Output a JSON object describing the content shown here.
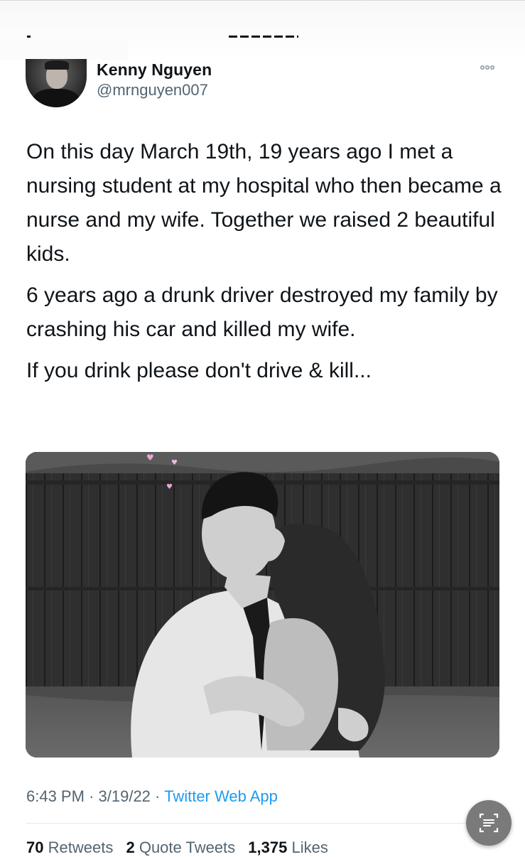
{
  "author": {
    "name": "Kenny Nguyen",
    "handle": "@mrnguyen007"
  },
  "tweet": {
    "paragraphs": [
      "On this day March 19th, 19 years ago I met a nursing student at my hospital who then became a nurse and my wife. Together we raised 2 beautiful kids.",
      "6 years ago a drunk driver destroyed my family by crashing his car and killed my wife.",
      "If you drink please don't drive & kill..."
    ]
  },
  "meta": {
    "time": "6:43 PM",
    "separator": "·",
    "date": "3/19/22",
    "source": "Twitter Web App"
  },
  "stats": {
    "retweets_count": "70",
    "retweets_label": "Retweets",
    "quotes_count": "2",
    "quotes_label": "Quote Tweets",
    "likes_count": "1,375",
    "likes_label": "Likes"
  },
  "colors": {
    "link": "#1d9bf0",
    "secondary": "#536471",
    "text": "#0f1419"
  },
  "icons": {
    "more": "more-icon",
    "scan": "scan-text-icon"
  }
}
